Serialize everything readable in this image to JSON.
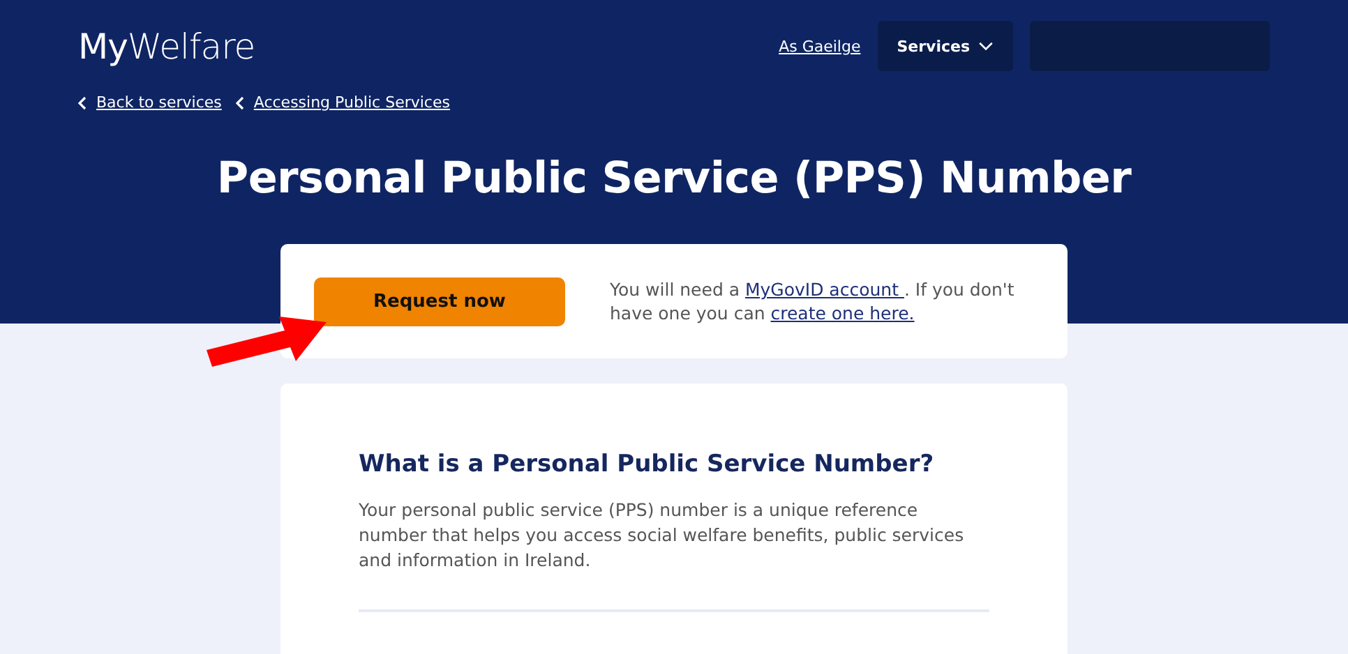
{
  "header": {
    "logo": "**My**Welfare",
    "language_link": "As Gaeilge",
    "services_menu": {
      "label": "Services",
      "expanded": false
    },
    "breadcrumbs": [
      "Back to services",
      "Accessing Public Services"
    ],
    "title": "Personal Public Service (PPS) Number"
  },
  "request_card": {
    "button": "Request now",
    "note_before": "You will need a ",
    "link_1": "MyGovID account ",
    "note_middle": ". If you don't have one you can ",
    "link_2": "create one here."
  },
  "info_card": {
    "heading": "What is a Personal Public Service Number?",
    "paragraph": "Your personal public service (PPS) number is a unique reference number that helps you access social welfare benefits, public services and information in Ireland."
  }
}
